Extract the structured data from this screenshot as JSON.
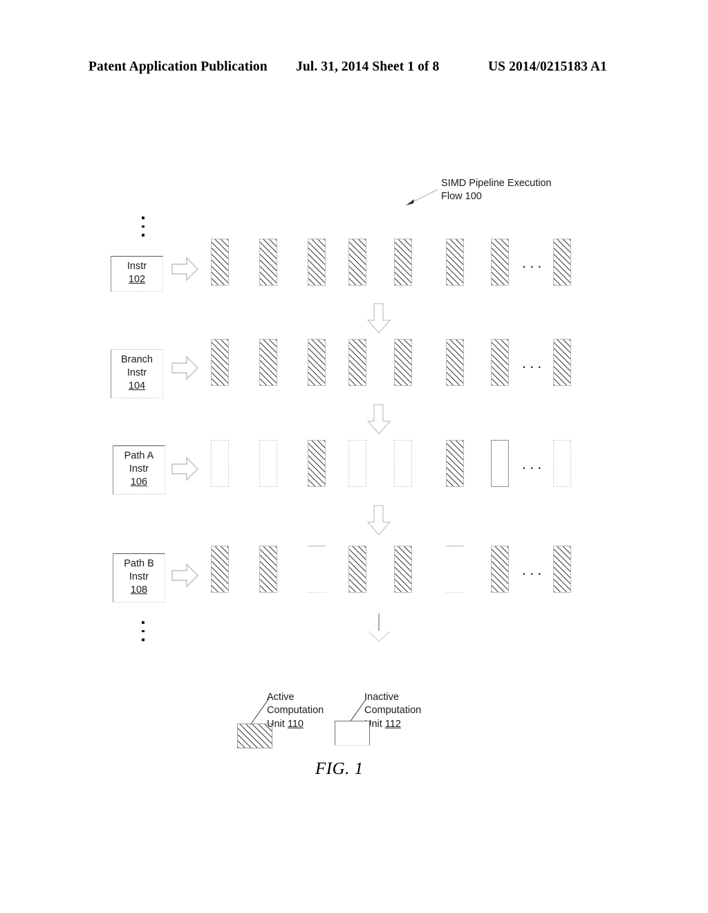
{
  "header": {
    "left": "Patent Application Publication",
    "middle": "Jul. 31, 2014   Sheet 1 of 8",
    "right": "US 2014/0215183 A1"
  },
  "figure": {
    "caption": "FIG. 1",
    "callout": "SIMD Pipeline Execution\nFlow 100",
    "ellipsis_horizontal": "...",
    "rows": [
      {
        "id": "instr-102",
        "label": "Instr",
        "number": "102",
        "units": [
          "active",
          "active",
          "active",
          "active",
          "active",
          "active",
          "active",
          "active"
        ]
      },
      {
        "id": "branch-instr-104",
        "label": "Branch\nInstr",
        "number": "104",
        "units": [
          "active",
          "active",
          "active",
          "active",
          "active",
          "active",
          "active",
          "active"
        ]
      },
      {
        "id": "path-a-instr-106",
        "label": "Path A\nInstr",
        "number": "106",
        "units": [
          "inactive",
          "inactive",
          "active",
          "inactive",
          "inactive",
          "active",
          "inactive",
          "inactive"
        ]
      },
      {
        "id": "path-b-instr-108",
        "label": "Path B\nInstr",
        "number": "108",
        "units": [
          "active",
          "active",
          "inactive",
          "active",
          "active",
          "inactive",
          "active",
          "active"
        ]
      }
    ],
    "legend": [
      {
        "id": "active-computation-unit",
        "text": "Active\nComputation\nUnit ",
        "number": "110",
        "style": "active"
      },
      {
        "id": "inactive-computation-unit",
        "text": "Inactive\nComputation\nUnit ",
        "number": "112",
        "style": "inactive"
      }
    ]
  }
}
